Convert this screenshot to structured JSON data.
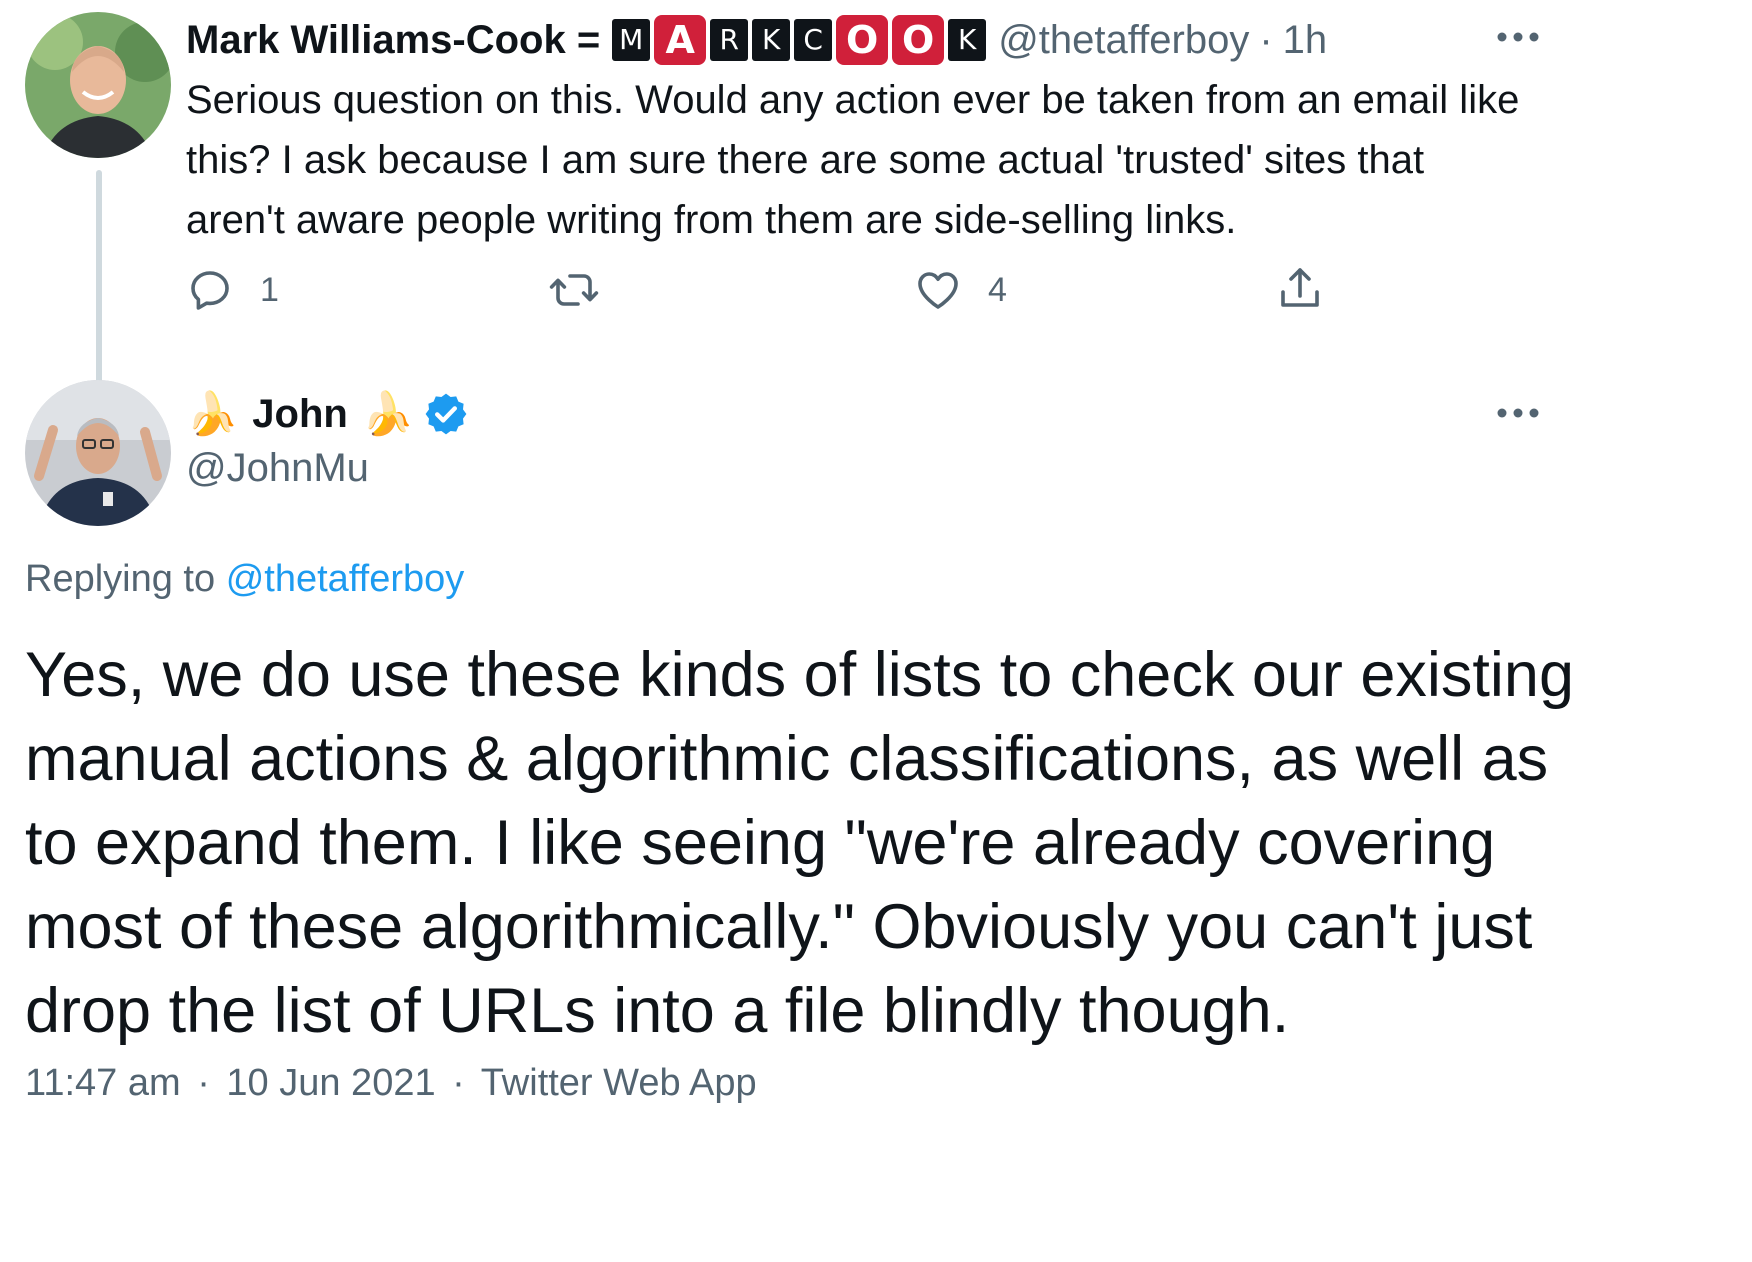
{
  "parent": {
    "name": "Mark Williams-Cook =",
    "badge_tiles": [
      {
        "char": "M",
        "style": "sq"
      },
      {
        "char": "A",
        "style": "red"
      },
      {
        "char": "R",
        "style": "sq"
      },
      {
        "char": "K",
        "style": "sq"
      },
      {
        "char": "C",
        "style": "sq"
      },
      {
        "char": "O",
        "style": "red"
      },
      {
        "char": "O",
        "style": "red"
      },
      {
        "char": "K",
        "style": "sq"
      }
    ],
    "handle": "@thetafferboy",
    "separator": "·",
    "time": "1h",
    "text_line1": "Serious question on this. Would any action ever be taken from an email like",
    "text_line2": "this? I ask because I am sure there are some actual 'trusted' sites that",
    "text_line3": "aren't aware people writing from them are side-selling links.",
    "replies": "1",
    "likes": "4",
    "more_icon": "more-dots-icon"
  },
  "main": {
    "name": "John",
    "name_emoji": "🍌",
    "verified_icon": "verified-badge-icon",
    "handle": "@JohnMu",
    "replying_prefix": "Replying to",
    "replying_handle": "@thetafferboy",
    "text_line1": "Yes, we do use these kinds of lists to check our existing",
    "text_line2": "manual actions & algorithmic classifications, as well as",
    "text_line3": "to expand them. I like seeing \"we're already covering",
    "text_line4": "most of these algorithmically.\" Obviously you can't just",
    "text_line5": "drop the list of URLs into a file blindly though.",
    "time": "11:47 am",
    "date": "10 Jun 2021",
    "source": "Twitter Web App",
    "separator": "·"
  },
  "colors": {
    "text": "#0f1419",
    "muted": "#536471",
    "link": "#1d9bf0",
    "thread_line": "#cfd9de",
    "badge_red": "#d0203a",
    "verified": "#1d9bf0"
  }
}
